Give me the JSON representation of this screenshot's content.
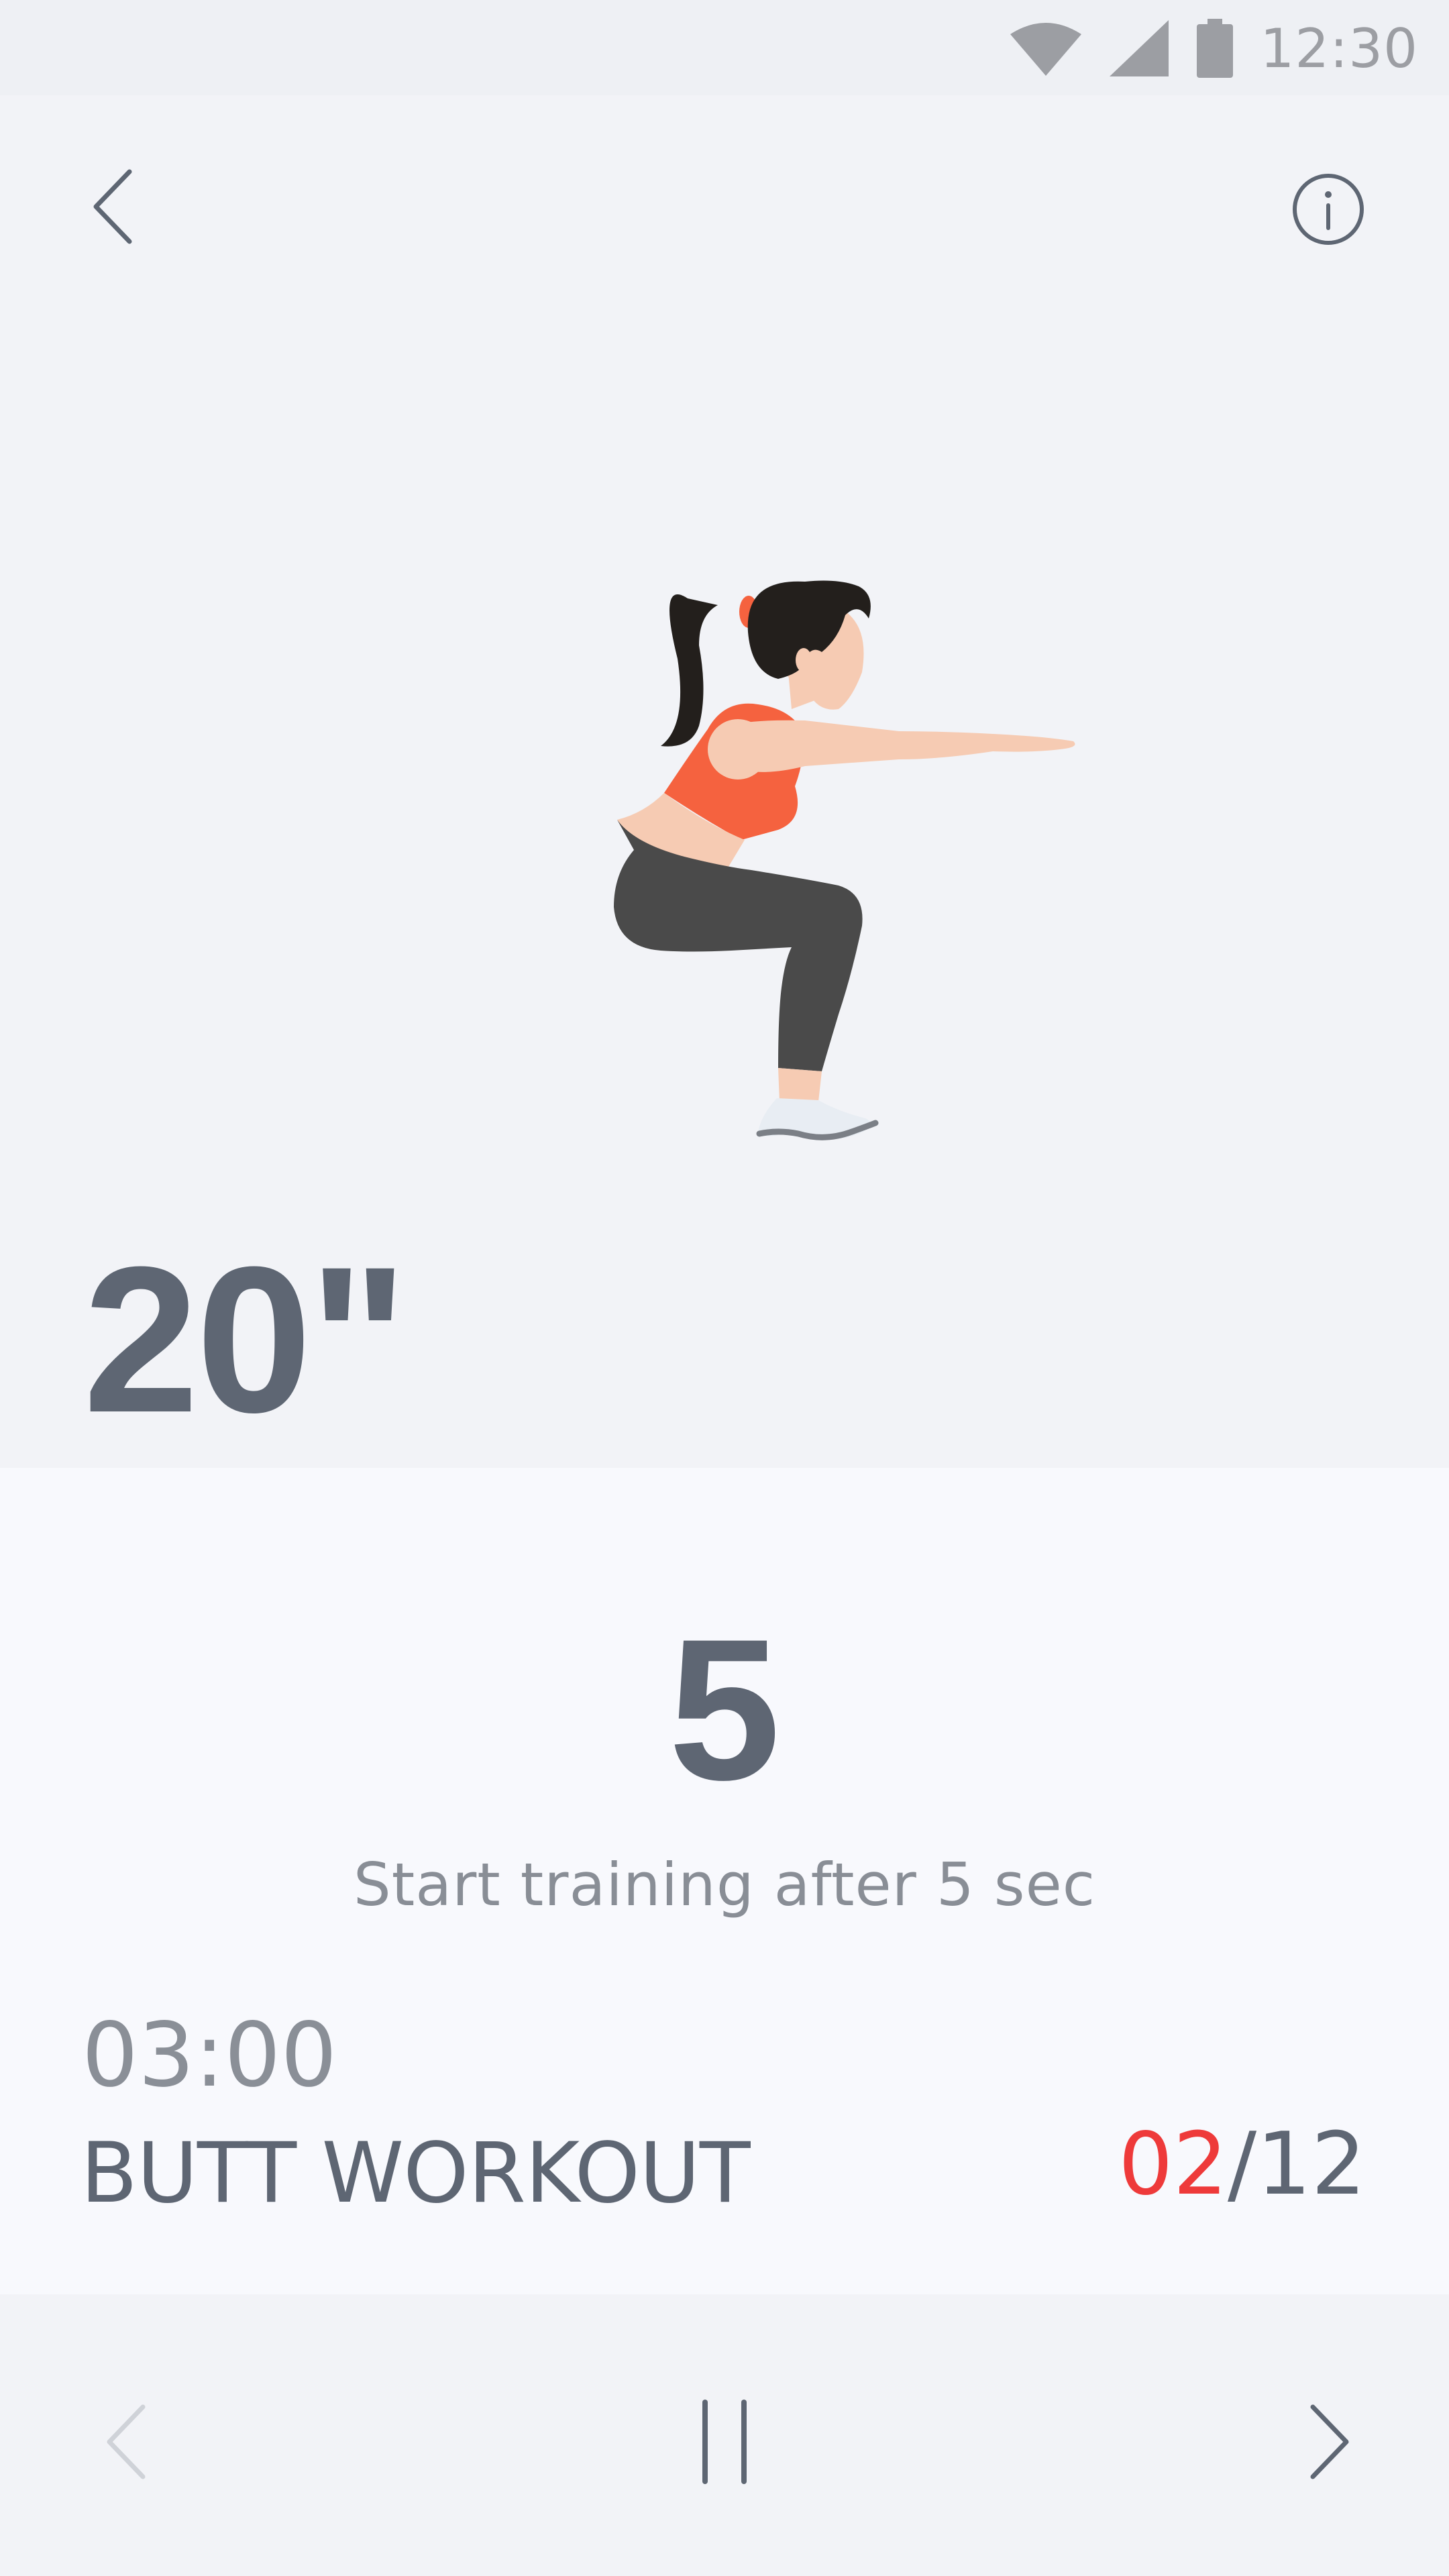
{
  "status_bar": {
    "time": "12:30",
    "icons": [
      "wifi-icon",
      "cellular-signal-icon",
      "battery-icon"
    ]
  },
  "header": {
    "back_icon": "chevron-left-icon",
    "info_icon": "info-icon"
  },
  "exercise": {
    "illustration": "woman-squat-illustration",
    "duration": "20\""
  },
  "countdown": {
    "number": "5",
    "text": "Start training after 5 sec"
  },
  "workout": {
    "total_time": "03:00",
    "name": "BUTT WORKOUT",
    "progress_current": "02",
    "progress_total": "/12"
  },
  "controls": {
    "prev_icon": "chevron-left-icon",
    "pause_icon": "pause-icon",
    "next_icon": "chevron-right-icon"
  },
  "colors": {
    "primary_text": "#5e6673",
    "secondary_text": "#898e96",
    "accent_red": "#ee3a3a",
    "hero_bg": "#f2f3f7",
    "panel_bg": "#f8f9fd",
    "top_color": "#f5623f",
    "pants_color": "#4a4a4a",
    "skin_color": "#f6cbb3"
  }
}
